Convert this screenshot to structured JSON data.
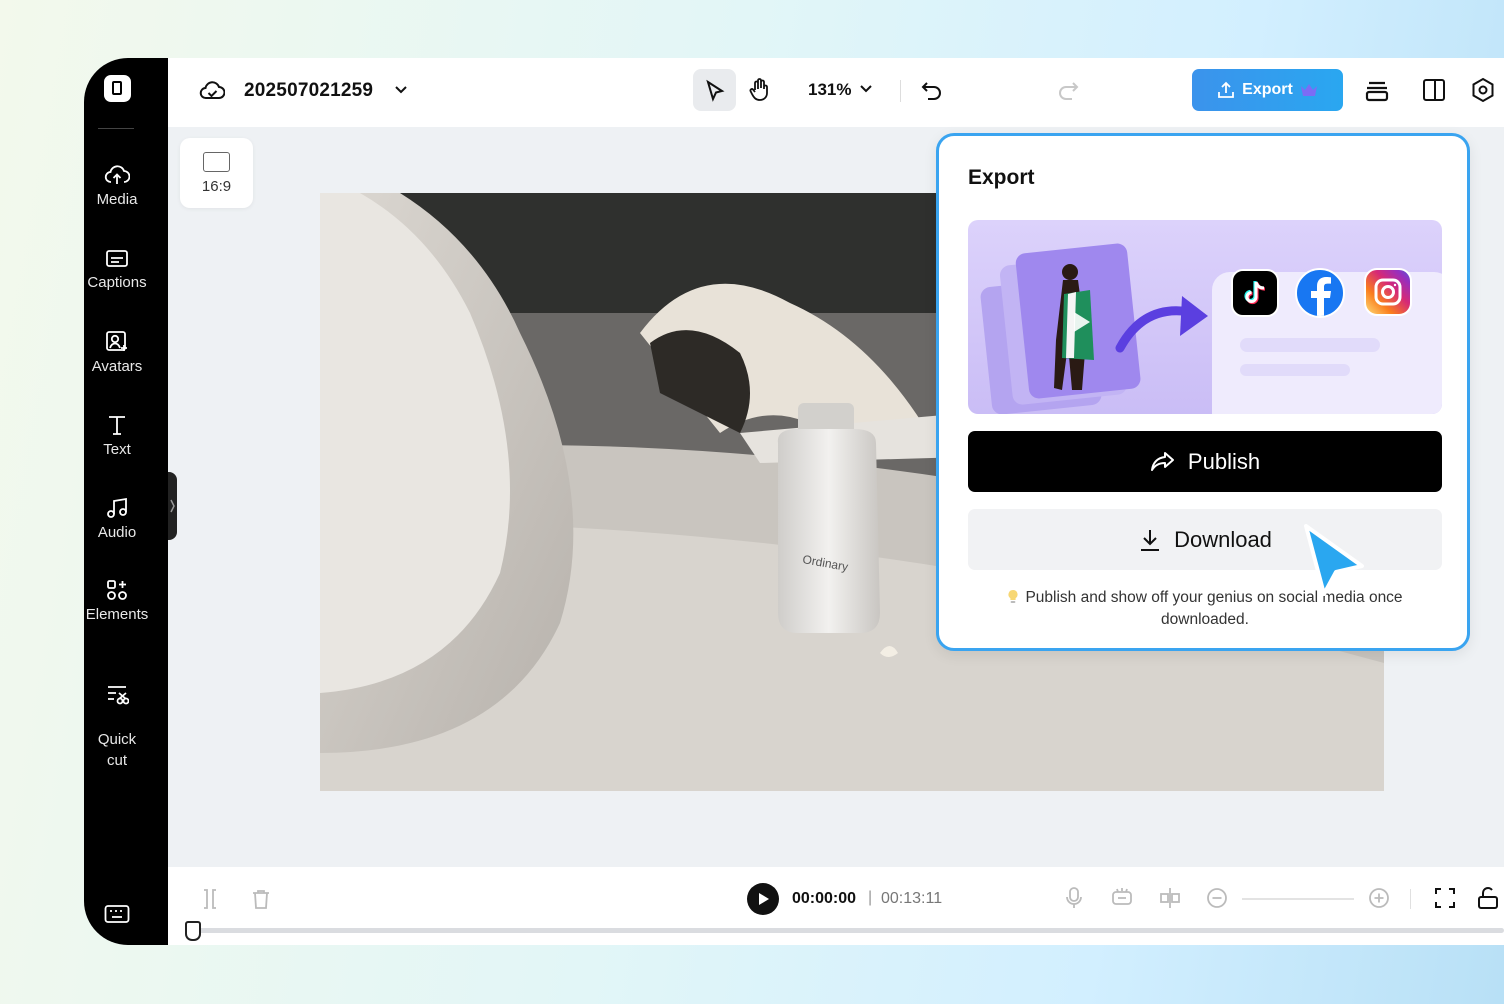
{
  "sidebar": {
    "items": [
      {
        "label": "Media",
        "icon": "cloud-upload-icon"
      },
      {
        "label": "Captions",
        "icon": "captions-icon"
      },
      {
        "label": "Avatars",
        "icon": "avatar-icon"
      },
      {
        "label": "Text",
        "icon": "text-icon"
      },
      {
        "label": "Audio",
        "icon": "music-note-icon"
      },
      {
        "label": "Elements",
        "icon": "elements-icon"
      },
      {
        "label": "Quick\ncut",
        "icon": "quick-cut-icon"
      }
    ]
  },
  "topbar": {
    "project_name": "202507021259",
    "zoom": "131%",
    "export_label": "Export"
  },
  "canvas": {
    "aspect_ratio": "16:9"
  },
  "export_panel": {
    "title": "Export",
    "publish_label": "Publish",
    "download_label": "Download",
    "note": "Publish and show off your genius on social media once downloaded.",
    "social_icons": [
      "tiktok-icon",
      "facebook-icon",
      "instagram-icon"
    ]
  },
  "timeline": {
    "current_time": "00:00:00",
    "separator": "|",
    "total_time": "00:13:11"
  },
  "colors": {
    "accent": "#3aa4f0",
    "export_button": "#3b93ec",
    "sidebar_bg": "#000000"
  }
}
